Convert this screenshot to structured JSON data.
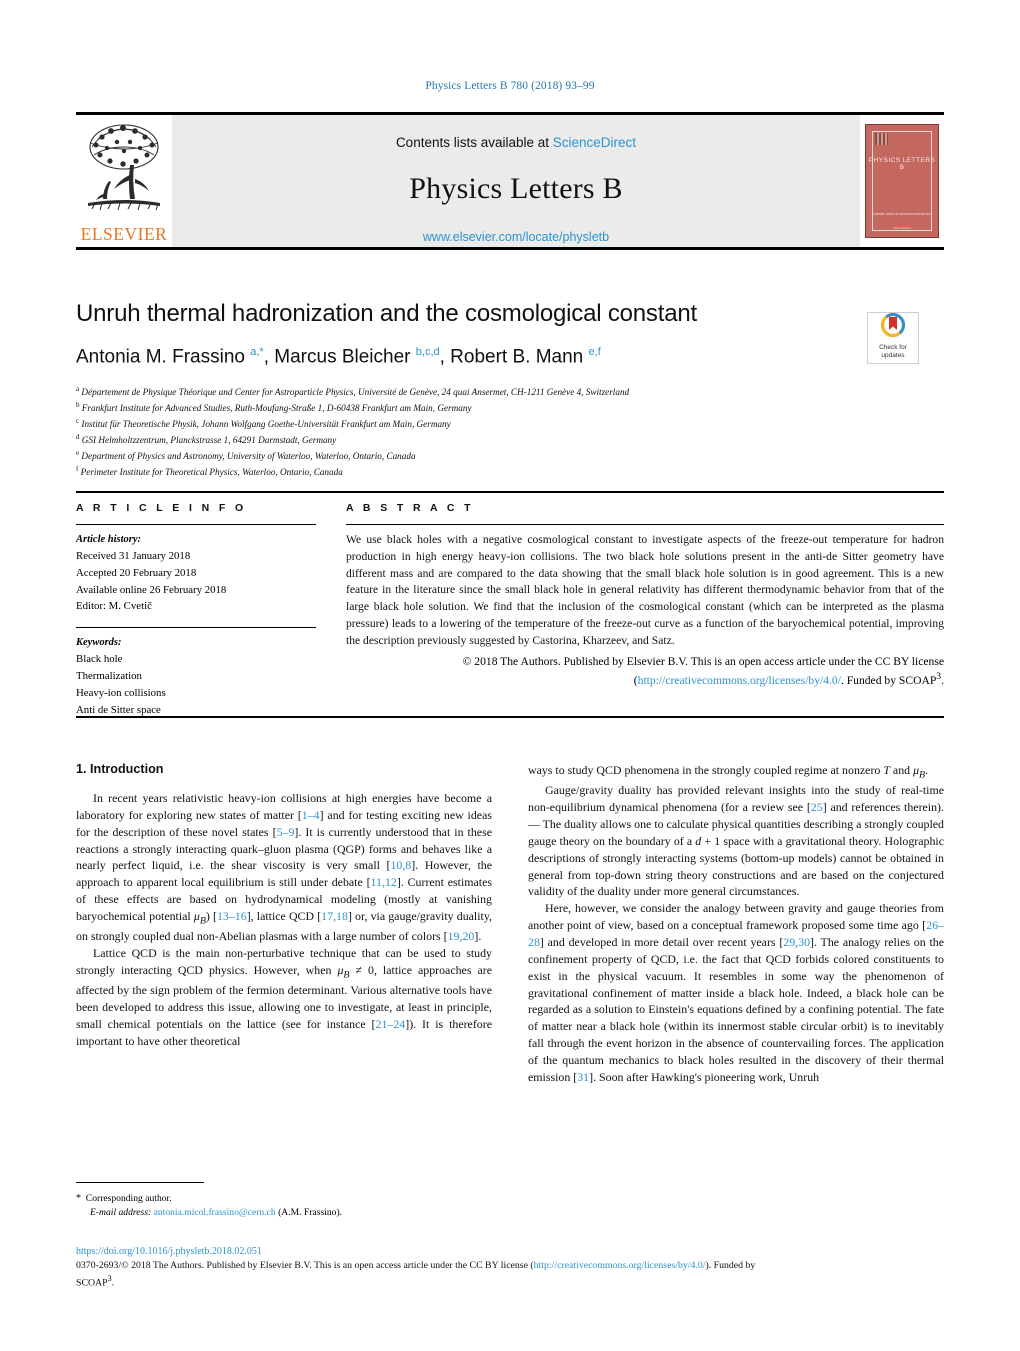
{
  "running_head": "Physics Letters B 780 (2018) 93–99",
  "masthead": {
    "contents_prefix": "Contents lists available at ",
    "sciencedirect": "ScienceDirect",
    "journal_title": "Physics Letters B",
    "journal_url": "www.elsevier.com/locate/physletb",
    "publisher_wordmark": "ELSEVIER",
    "publisher_color": "#e87722",
    "link_color": "#2c93d0",
    "cover": {
      "title": "PHYSICS LETTERS B",
      "foot_line1": "Available online at www.sciencedirect.com",
      "foot_line2": "ScienceDirect",
      "bg_color": "#c4685f"
    }
  },
  "article": {
    "title": "Unruh thermal hadronization and the cosmological constant",
    "authors_html": "Antonia M. Frassino <sup>a,*</sup>, Marcus Bleicher <sup>b,c,d</sup>, Robert B. Mann <sup>e,f</sup>",
    "affiliations": [
      {
        "mark": "a",
        "text": "Département de Physique Théorique and Center for Astroparticle Physics, Université de Genève, 24 quai Ansermet, CH-1211 Genève 4, Switzerland"
      },
      {
        "mark": "b",
        "text": "Frankfurt Institute for Advanced Studies, Ruth-Moufang-Straße 1, D-60438 Frankfurt am Main, Germany"
      },
      {
        "mark": "c",
        "text": "Institut für Theoretische Physik, Johann Wolfgang Goethe-Universität Frankfurt am Main, Germany"
      },
      {
        "mark": "d",
        "text": "GSI Helmholtzzentrum, Planckstrasse 1, 64291 Darmstadt, Germany"
      },
      {
        "mark": "e",
        "text": "Department of Physics and Astronomy, University of Waterloo, Waterloo, Ontario, Canada"
      },
      {
        "mark": "f",
        "text": "Perimeter Institute for Theoretical Physics, Waterloo, Ontario, Canada"
      }
    ],
    "crossmark_label_line1": "Check for",
    "crossmark_label_line2": "updates"
  },
  "article_info": {
    "heading": "A R T I C L E    I N F O",
    "history_label": "Article history:",
    "history": [
      "Received 31 January 2018",
      "Accepted 20 February 2018",
      "Available online 26 February 2018",
      "Editor: M. Cvetič"
    ],
    "keywords_label": "Keywords:",
    "keywords": [
      "Black hole",
      "Thermalization",
      "Heavy-ion collisions",
      "Anti de Sitter space"
    ]
  },
  "abstract": {
    "heading": "A B S T R A C T",
    "text": "We use black holes with a negative cosmological constant to investigate aspects of the freeze-out temperature for hadron production in high energy heavy-ion collisions. The two black hole solutions present in the anti-de Sitter geometry have different mass and are compared to the data showing that the small black hole solution is in good agreement. This is a new feature in the literature since the small black hole in general relativity has different thermodynamic behavior from that of the large black hole solution. We find that the inclusion of the cosmological constant (which can be interpreted as the plasma pressure) leads to a lowering of the temperature of the freeze-out curve as a function of the baryochemical potential, improving the description previously suggested by Castorina, Kharzeev, and Satz.",
    "copyright_pre": "© 2018 The Authors. Published by Elsevier B.V. This is an open access article under the CC BY license",
    "license_url": "http://creativecommons.org/licenses/by/4.0/",
    "copyright_post": ". Funded by SCOAP",
    "scoap_sup": "3",
    "copyright_end": "."
  },
  "body": {
    "section_heading": "1. Introduction",
    "left_paragraphs": [
      "In recent years relativistic heavy-ion collisions at high energies have become a laboratory for exploring new states of matter [1–4] and for testing exciting new ideas for the description of these novel states [5–9]. It is currently understood that in these reactions a strongly interacting quark–gluon plasma (QGP) forms and behaves like a nearly perfect liquid, i.e. the shear viscosity is very small [10,8]. However, the approach to apparent local equilibrium is still under debate [11,12]. Current estimates of these effects are based on hydrodynamical modeling (mostly at vanishing baryochemical potential μB) [13–16], lattice QCD [17,18] or, via gauge/gravity duality, on strongly coupled dual non-Abelian plasmas with a large number of colors [19,20].",
      "Lattice QCD is the main non-perturbative technique that can be used to study strongly interacting QCD physics. However, when μB ≠ 0, lattice approaches are affected by the sign problem of the fermion determinant. Various alternative tools have been developed to address this issue, allowing one to investigate, at least in principle, small chemical potentials on the lattice (see for instance [21–24]). It is therefore important to have other theoretical"
    ],
    "right_paragraphs": [
      "ways to study QCD phenomena in the strongly coupled regime at nonzero T and μB.",
      "Gauge/gravity duality has provided relevant insights into the study of real-time non-equilibrium dynamical phenomena (for a review see [25] and references therein). — The duality allows one to calculate physical quantities describing a strongly coupled gauge theory on the boundary of a d + 1 space with a gravitational theory. Holographic descriptions of strongly interacting systems (bottom-up models) cannot be obtained in general from top-down string theory constructions and are based on the conjectured validity of the duality under more general circumstances.",
      "Here, however, we consider the analogy between gravity and gauge theories from another point of view, based on a conceptual framework proposed some time ago [26–28] and developed in more detail over recent years [29,30]. The analogy relies on the confinement property of QCD, i.e. the fact that QCD forbids colored constituents to exist in the physical vacuum. It resembles in some way the phenomenon of gravitational confinement of matter inside a black hole. Indeed, a black hole can be regarded as a solution to Einstein's equations defined by a confining potential. The fate of matter near a black hole (within its innermost stable circular orbit) is to inevitably fall through the event horizon in the absence of countervailing forces. The application of the quantum mechanics to black holes resulted in the discovery of their thermal emission [31]. Soon after Hawking's pioneering work, Unruh"
    ]
  },
  "footnotes": {
    "corresponding_mark": "*",
    "corresponding_text": "Corresponding author.",
    "email_label": "E-mail address:",
    "email": "antonia.micol.frassino@cern.ch",
    "email_suffix": "(A.M. Frassino)."
  },
  "bottom": {
    "doi": "https://doi.org/10.1016/j.physletb.2018.02.051",
    "issn_copy_pre": "0370-2693/© 2018 The Authors. Published by Elsevier B.V. This is an open access article under the CC BY license (",
    "license_url": "http://creativecommons.org/licenses/by/4.0/",
    "issn_copy_post": "). Funded by",
    "issn_copy_tail": "SCOAP",
    "issn_copy_sup": "3",
    "issn_copy_end": "."
  }
}
